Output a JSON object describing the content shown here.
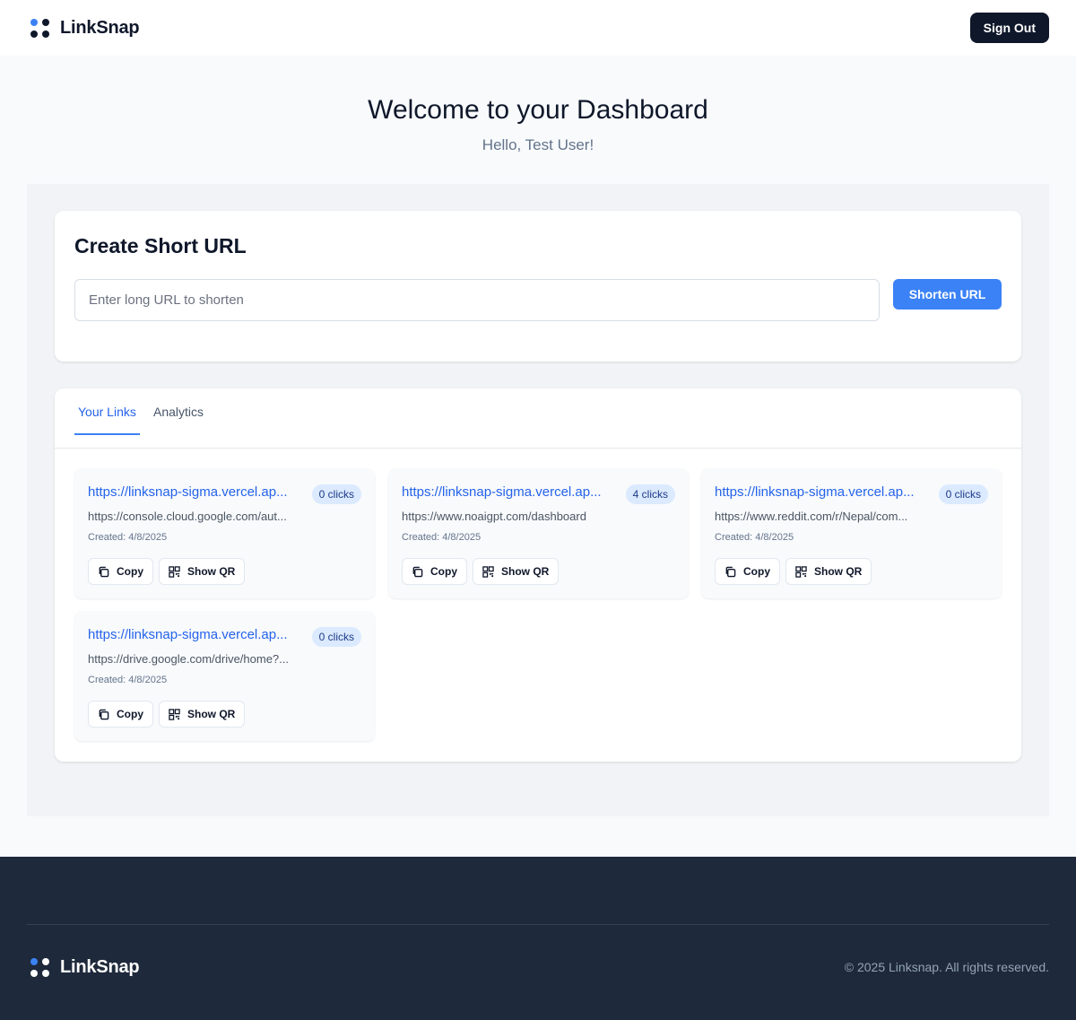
{
  "app": {
    "name": "LinkSnap",
    "logo_colors": {
      "accent": "#3b82f6",
      "dark": "#0f172a",
      "light": "#ffffff"
    }
  },
  "header": {
    "sign_out_label": "Sign Out"
  },
  "hero": {
    "title": "Welcome to your Dashboard",
    "subtitle": "Hello, Test User!"
  },
  "create": {
    "title": "Create Short URL",
    "input_placeholder": "Enter long URL to shorten",
    "input_value": "",
    "button_label": "Shorten URL"
  },
  "tabs": [
    {
      "label": "Your Links",
      "active": true
    },
    {
      "label": "Analytics",
      "active": false
    }
  ],
  "links": [
    {
      "short_url": "https://linksnap-sigma.vercel.ap...",
      "clicks": "0 clicks",
      "long_url": "https://console.cloud.google.com/aut...",
      "created": "Created: 4/8/2025",
      "copy_label": "Copy",
      "qr_label": "Show QR"
    },
    {
      "short_url": "https://linksnap-sigma.vercel.ap...",
      "clicks": "4 clicks",
      "long_url": "https://www.noaigpt.com/dashboard",
      "created": "Created: 4/8/2025",
      "copy_label": "Copy",
      "qr_label": "Show QR"
    },
    {
      "short_url": "https://linksnap-sigma.vercel.ap...",
      "clicks": "0 clicks",
      "long_url": "https://www.reddit.com/r/Nepal/com...",
      "created": "Created: 4/8/2025",
      "copy_label": "Copy",
      "qr_label": "Show QR"
    },
    {
      "short_url": "https://linksnap-sigma.vercel.ap...",
      "clicks": "0 clicks",
      "long_url": "https://drive.google.com/drive/home?...",
      "created": "Created: 4/8/2025",
      "copy_label": "Copy",
      "qr_label": "Show QR"
    }
  ],
  "footer": {
    "brand": "LinkSnap",
    "copyright": "© 2025 Linksnap. All rights reserved."
  },
  "colors": {
    "primary": "#3b82f6",
    "link": "#2563eb",
    "dark": "#0f172a",
    "footer_bg": "#1e293b",
    "badge_bg": "#dbeafe"
  }
}
